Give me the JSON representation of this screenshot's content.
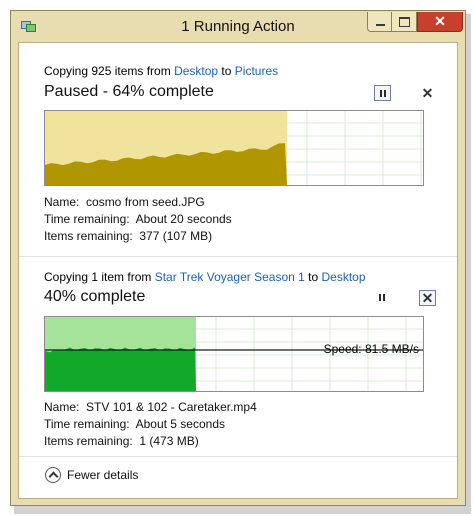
{
  "window": {
    "title": "1 Running Action"
  },
  "op1": {
    "copying_prefix": "Copying 925 items from ",
    "source": "Desktop",
    "to_word": " to ",
    "destination": "Pictures",
    "status": "Paused - 64% complete",
    "progress_fraction": 0.64,
    "name_label": "Name:",
    "name_value": "cosmo from seed.JPG",
    "time_label": "Time remaining:",
    "time_value": "About 20 seconds",
    "items_label": "Items remaining:",
    "items_value": "377 (107 MB)",
    "colors": {
      "fill_light": "#f0e49c",
      "fill_dark": "#b09600"
    }
  },
  "op2": {
    "copying_prefix": "Copying 1 item from ",
    "source": "Star Trek Voyager Season 1",
    "to_word": " to ",
    "destination": "Desktop",
    "status": "40% complete",
    "progress_fraction": 0.4,
    "speed_text": "Speed: 81.5 MB/s",
    "name_label": "Name:",
    "name_value": "STV 101 & 102 - Caretaker.mp4",
    "time_label": "Time remaining:",
    "time_value": "About 5 seconds",
    "items_label": "Items remaining:",
    "items_value": "1 (473 MB)",
    "colors": {
      "fill_light": "#a6e39a",
      "fill_dark": "#12a82a"
    }
  },
  "footer": {
    "fewer_details": "Fewer details"
  },
  "icons": {
    "app": "copy-icon",
    "pause": "pause-icon",
    "cancel": "close-icon",
    "collapse": "chevron-up-icon"
  },
  "cancel_glyph": "✕"
}
